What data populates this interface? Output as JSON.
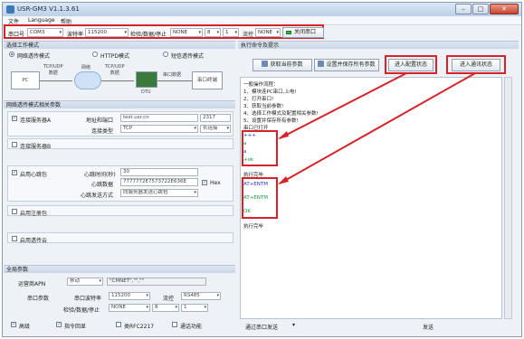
{
  "window": {
    "title": "USR-GM3 V1.1.3.61",
    "min_label": "–",
    "max_label": "□",
    "close_label": "✕"
  },
  "menu": [
    "文件",
    "Language",
    "帮助"
  ],
  "toolbar": {
    "port_label": "串口号",
    "port_value": "COM3",
    "baud_label": "波特率",
    "baud_value": "115200",
    "parity_label": "检验/数据/停止",
    "parity_value": "NONE",
    "data_value": "8",
    "stop_value": "1",
    "flow_label": "流控",
    "flow_value": "NONE",
    "close_button": "关闭串口",
    "status_color": "#2dbb3a"
  },
  "work_mode": {
    "section_title": "选择工作模式",
    "modes": [
      {
        "label": "网络透传模式",
        "selected": true
      },
      {
        "label": "HTTPD模式",
        "selected": false
      },
      {
        "label": "短信透传模式",
        "selected": false
      }
    ],
    "diagram": {
      "pc": "PC",
      "tcp_left": "TCP/UDP\n数据",
      "network": "网络",
      "tcp_right": "TCP/UDP\n数据",
      "dtu": "DTU",
      "serial_data": "串口数据",
      "serial_device": "串口终端"
    }
  },
  "net_params": {
    "section_title": "网络透传模式相关参数",
    "server_a": {
      "label": "连接服务器A",
      "checked": true,
      "addr_label": "地址和端口",
      "addr_value": "test.usr.cn",
      "port_value": "2317",
      "type_label": "连接类型",
      "type_value": "TCP",
      "conn_value": "长连接"
    },
    "server_b": {
      "label": "连接服务器B",
      "checked": false
    },
    "heartbeat": {
      "label": "启用心跳包",
      "checked": true,
      "time_label": "心跳时间(秒)",
      "time_value": "30",
      "data_label": "心跳数据",
      "data_value": "7777772E7573722E636E",
      "hex_label": "Hex",
      "hex_checked": true,
      "mode_label": "心跳发送方式",
      "mode_value": "向服务器发送心跳包"
    },
    "register": {
      "label": "启用注册包",
      "checked": false
    },
    "usr_cloud": {
      "label": "启用透传云",
      "checked": false
    }
  },
  "global": {
    "section_title": "全局参数",
    "apn_label": "运营商APN",
    "apn_value": "移动",
    "apn_string": "\"CMNET\",\"\",\"\"",
    "serial_label": "串口参数",
    "baud_label": "串口波特率",
    "baud_value": "115200",
    "flow_label": "流控",
    "flow_value": "RS485",
    "parity_label": "检验/数据/停止",
    "parity_value": "NONE",
    "data_value": "8",
    "stop_value": "1",
    "advanced_label": "高级",
    "echo_label": "指令回显",
    "rfc_label": "类RFC2217",
    "call_label": "通话功能"
  },
  "right": {
    "section_title": "执行命令及提示",
    "buttons": {
      "get_params": "获取当前参数",
      "save_all": "设置并保存所有参数",
      "enter_config": "进入配置状态",
      "enter_comm": "进入通讯状态"
    },
    "log_lines": [
      {
        "text": "一般操作流程：",
        "style": ""
      },
      {
        "text": "1、模块连PC串口,上电!",
        "style": ""
      },
      {
        "text": "2、打开串口!",
        "style": ""
      },
      {
        "text": "3、获取当前参数!",
        "style": ""
      },
      {
        "text": "4、选择工作模式及配置相关参数!",
        "style": ""
      },
      {
        "text": "5、设置并保存所有参数!",
        "style": ""
      },
      {
        "text": "串口已打开",
        "style": ""
      },
      {
        "text": "+++",
        "style": "blue"
      },
      {
        "text": "a",
        "style": "green"
      },
      {
        "text": "a",
        "style": "blue"
      },
      {
        "text": "+ok",
        "style": "green"
      },
      {
        "text": "执行完毕",
        "style": ""
      },
      {
        "text": "AT+ENTM",
        "style": "blue"
      },
      {
        "text": "AT+ENTM",
        "style": "green"
      },
      {
        "text": "OK",
        "style": "green"
      },
      {
        "text": "执行完毕",
        "style": ""
      }
    ],
    "footer_left": "通过串口发送",
    "footer_right": "发送"
  }
}
